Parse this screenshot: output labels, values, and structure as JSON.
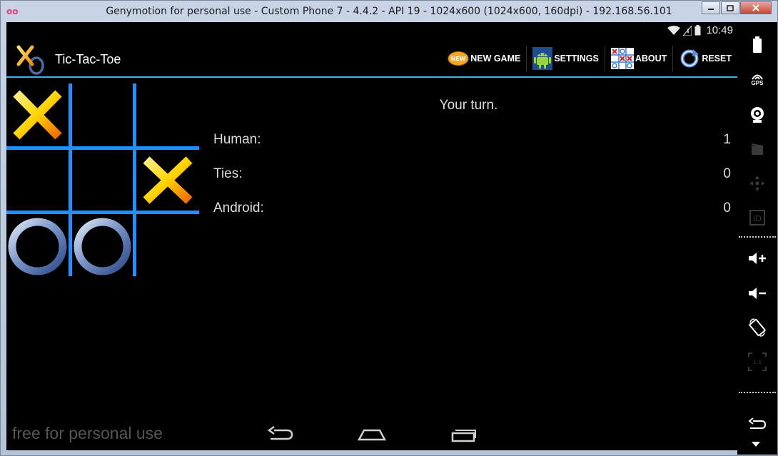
{
  "window": {
    "title": "Genymotion for personal use - Custom Phone 7 - 4.4.2 - API 19 - 1024x600 (1024x600, 160dpi) - 192.168.56.101",
    "app_icon": "oo",
    "buttons": {
      "minimize_icon": "minimize-icon",
      "maximize_icon": "maximize-icon",
      "close_icon": "close-icon"
    }
  },
  "statusbar": {
    "time": "10:49",
    "icons": [
      "wifi-icon",
      "signal-icon",
      "battery-icon"
    ]
  },
  "actionbar": {
    "title": "Tic-Tac-Toe",
    "actions": [
      {
        "label": "NEW GAME",
        "icon": "new-badge-icon"
      },
      {
        "label": "SETTINGS",
        "icon": "android-icon"
      },
      {
        "label": "ABOUT",
        "icon": "about-grid-icon"
      },
      {
        "label": "RESET",
        "icon": "reset-icon"
      }
    ]
  },
  "board": {
    "cells": [
      "X",
      "",
      "",
      "",
      "",
      "X",
      "O",
      "O",
      ""
    ]
  },
  "game": {
    "status": "Your turn.",
    "scores": [
      {
        "label": "Human:",
        "value": "1"
      },
      {
        "label": "Ties:",
        "value": "0"
      },
      {
        "label": "Android:",
        "value": "0"
      }
    ]
  },
  "watermark": "free for personal use",
  "navbar": {
    "back": "back-icon",
    "home": "home-icon",
    "recents": "recents-icon"
  },
  "side_toolbar": {
    "battery_label": "",
    "gps_label": "GPS",
    "id_label": "ID",
    "pixel_label": "1:1",
    "tools": [
      "battery-icon",
      "gps-icon",
      "camera-icon",
      "media-icon",
      "dpad-icon",
      "id-icon",
      "volume-up-icon",
      "volume-down-icon",
      "rotate-icon",
      "pixel-perfect-icon",
      "back-icon"
    ]
  },
  "colors": {
    "accent": "#33b5e5",
    "grid": "#1e90ff",
    "x_yellow": "#ffd400",
    "x_orange": "#f47a00",
    "o_blue": "#3a5a9a"
  }
}
